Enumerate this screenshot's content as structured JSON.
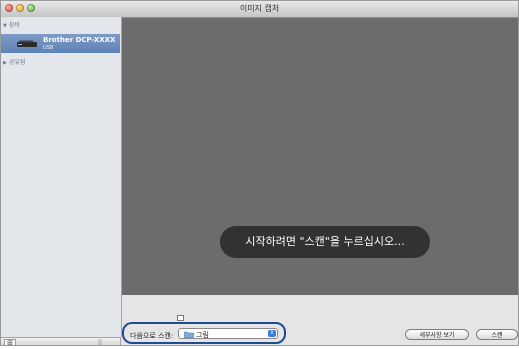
{
  "window": {
    "title": "이미지 캡처"
  },
  "sidebar": {
    "devices_header": "장비",
    "device": {
      "name": "Brother DCP-XXXX",
      "connection": "USB"
    },
    "shared_header": "공유됨",
    "bottom": {
      "add_symbol": "⊞",
      "grip": "||"
    }
  },
  "preview": {
    "message": "시작하려면 \"스캔\"을 누르십시오..."
  },
  "controls": {
    "scan_to_label": "다음으로 스캔:",
    "scan_to_value": "그림",
    "checkbox_label": "",
    "details_button": "세부사항 보기",
    "scan_button": "스캔"
  },
  "colors": {
    "preview_bg": "#6c6c6c",
    "sidebar_selection": "#6a8cc0",
    "highlight_ring": "#1f4b93"
  }
}
